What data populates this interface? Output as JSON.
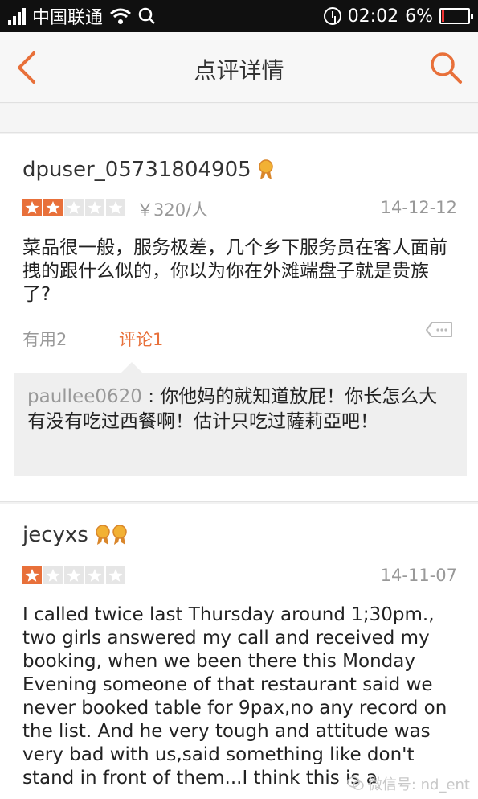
{
  "status_bar": {
    "carrier": "中国联通",
    "time": "02:02",
    "battery": "6%",
    "icons": [
      "signal-icon",
      "wifi-icon",
      "search-icon",
      "alarm-icon",
      "battery-icon"
    ]
  },
  "nav": {
    "title": "点评详情",
    "back_icon": "chevron-left-icon",
    "search_icon": "search-icon",
    "accent_color": "#e8703a"
  },
  "reviews": [
    {
      "username": "dpuser_05731804905",
      "rating": 2,
      "rating_max": 5,
      "price": "￥320/人",
      "date": "14-12-12",
      "text": "菜品很一般，服务极差，几个乡下服务员在客人面前拽的跟什么似的，你以为你在外滩端盘子就是贵族了?",
      "useful": "有用2",
      "comments_label": "评论1",
      "comment": {
        "user": "paullee0620",
        "separator": ":",
        "text": "你他妈的就知道放屁！你长怎么大有没有吃过西餐啊！估计只吃过薩莉亞吧！"
      }
    },
    {
      "username": "jecyxs",
      "rating": 1,
      "rating_max": 5,
      "date": "14-11-07",
      "text": "I called twice last Thursday around 1;30pm., two girls answered my call and received my booking, when we been there this Monday Evening someone of that restaurant said we never booked table for 9pax,no any record on the list. And he very tough and attitude was very bad with us,said something like don't stand in front of them...I think this is a"
    }
  ],
  "watermark": "微信号: nd_ent"
}
